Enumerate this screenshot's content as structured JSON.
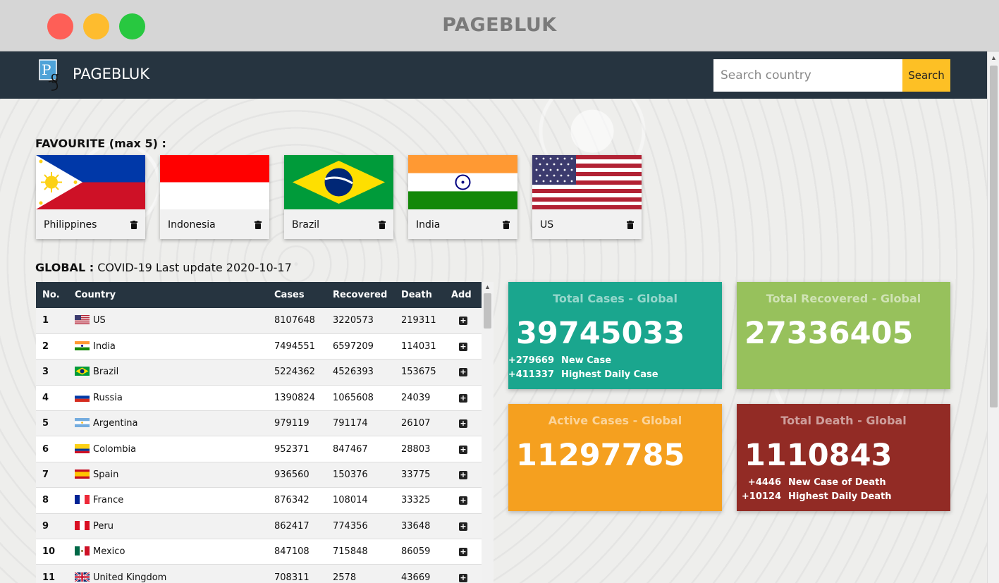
{
  "window": {
    "title": "PAGEBLUK"
  },
  "navbar": {
    "brand": "PAGEBLUK",
    "search_placeholder": "Search country",
    "search_button": "Search"
  },
  "favourites": {
    "heading": "FAVOURITE (max 5) :",
    "items": [
      {
        "name": "Philippines",
        "flag": "philippines-flag"
      },
      {
        "name": "Indonesia",
        "flag": "indonesia-flag"
      },
      {
        "name": "Brazil",
        "flag": "brazil-flag"
      },
      {
        "name": "India",
        "flag": "india-flag"
      },
      {
        "name": "US",
        "flag": "us-flag"
      }
    ]
  },
  "global": {
    "label": "GLOBAL :",
    "subtitle": "COVID-19 Last update 2020-10-17"
  },
  "table": {
    "headers": {
      "no": "No.",
      "country": "Country",
      "cases": "Cases",
      "recovered": "Recovered",
      "death": "Death",
      "add": "Add"
    },
    "rows": [
      {
        "no": "1",
        "country": "US",
        "cases": "8107648",
        "recovered": "3220573",
        "death": "219311"
      },
      {
        "no": "2",
        "country": "India",
        "cases": "7494551",
        "recovered": "6597209",
        "death": "114031"
      },
      {
        "no": "3",
        "country": "Brazil",
        "cases": "5224362",
        "recovered": "4526393",
        "death": "153675"
      },
      {
        "no": "4",
        "country": "Russia",
        "cases": "1390824",
        "recovered": "1065608",
        "death": "24039"
      },
      {
        "no": "5",
        "country": "Argentina",
        "cases": "979119",
        "recovered": "791174",
        "death": "26107"
      },
      {
        "no": "6",
        "country": "Colombia",
        "cases": "952371",
        "recovered": "847467",
        "death": "28803"
      },
      {
        "no": "7",
        "country": "Spain",
        "cases": "936560",
        "recovered": "150376",
        "death": "33775"
      },
      {
        "no": "8",
        "country": "France",
        "cases": "876342",
        "recovered": "108014",
        "death": "33325"
      },
      {
        "no": "9",
        "country": "Peru",
        "cases": "862417",
        "recovered": "774356",
        "death": "33648"
      },
      {
        "no": "10",
        "country": "Mexico",
        "cases": "847108",
        "recovered": "715848",
        "death": "86059"
      },
      {
        "no": "11",
        "country": "United Kingdom",
        "cases": "708311",
        "recovered": "2578",
        "death": "43669"
      }
    ]
  },
  "stats": {
    "total_cases": {
      "title": "Total Cases - Global",
      "value": "39745033",
      "new_value": "+279669",
      "new_label": "New Case",
      "high_value": "+411337",
      "high_label": "Highest Daily Case",
      "color": "#1aa68e"
    },
    "total_recovered": {
      "title": "Total Recovered - Global",
      "value": "27336405",
      "color": "#97c15c"
    },
    "active_cases": {
      "title": "Active Cases - Global",
      "value": "11297785",
      "color": "#f5a01f"
    },
    "total_death": {
      "title": "Total Death - Global",
      "value": "1110843",
      "new_value": "+4446",
      "new_label": "New Case of Death",
      "high_value": "+10124",
      "high_label": "Highest Daily Death",
      "color": "#922b25"
    }
  },
  "colors": {
    "navbar": "#263440",
    "search_button": "#fdc025"
  }
}
